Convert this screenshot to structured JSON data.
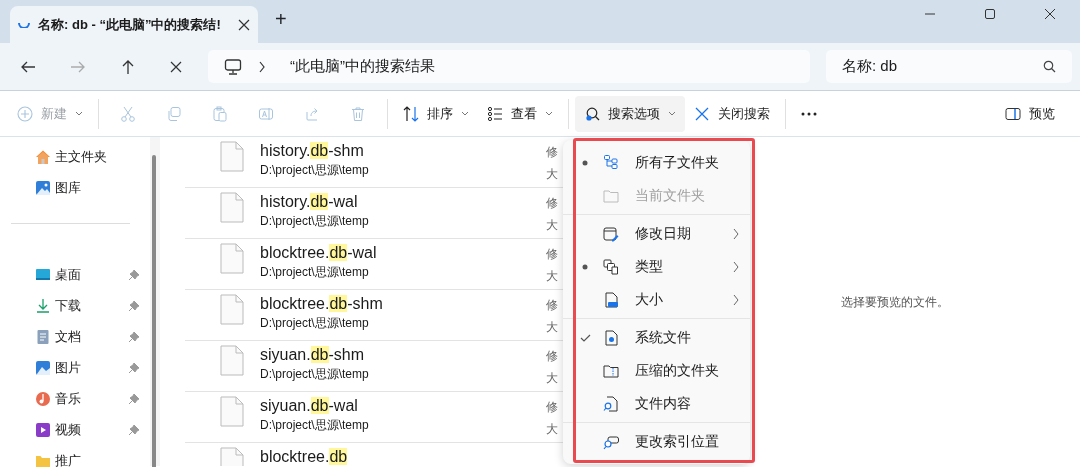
{
  "window": {
    "tab_title": "名称: db - “此电脑”中的搜索结!",
    "new_tab": "+"
  },
  "address": {
    "path": "“此电脑”中的搜索结果"
  },
  "search": {
    "value": "名称: db"
  },
  "toolbar": [
    {
      "kind": "new",
      "label": "新建",
      "disabled": true,
      "dropdown": true,
      "active": false
    },
    {
      "kind": "icon",
      "disabled": true,
      "dropdown": false,
      "active": false
    },
    {
      "kind": "icon",
      "disabled": true,
      "dropdown": false,
      "active": false
    },
    {
      "kind": "icon",
      "disabled": true,
      "dropdown": false,
      "active": false
    },
    {
      "kind": "icon",
      "disabled": true,
      "dropdown": false,
      "active": false
    },
    {
      "kind": "icon",
      "disabled": true,
      "dropdown": false,
      "active": false
    },
    {
      "kind": "icon",
      "disabled": true,
      "dropdown": false,
      "active": false
    },
    {
      "kind": "sort",
      "label": "排序",
      "disabled": false,
      "dropdown": true,
      "active": false
    },
    {
      "kind": "view",
      "label": "查看",
      "disabled": false,
      "dropdown": true,
      "active": false
    },
    {
      "kind": "search-options",
      "label": "搜索选项",
      "disabled": false,
      "dropdown": true,
      "active": true
    },
    {
      "kind": "close-search",
      "label": "关闭搜索",
      "disabled": false,
      "dropdown": false,
      "active": false
    },
    {
      "kind": "more",
      "disabled": false,
      "dropdown": false,
      "active": false
    }
  ],
  "preview_button": "预览",
  "sidebar": {
    "top": [
      {
        "label": "主文件夹",
        "pinned": false
      },
      {
        "label": "图库",
        "pinned": false
      }
    ],
    "items": [
      {
        "label": "桌面",
        "pinned": true
      },
      {
        "label": "下载",
        "pinned": true
      },
      {
        "label": "文档",
        "pinned": true
      },
      {
        "label": "图片",
        "pinned": true
      },
      {
        "label": "音乐",
        "pinned": true
      },
      {
        "label": "视频",
        "pinned": true
      },
      {
        "label": "推广",
        "pinned": false
      }
    ]
  },
  "files": [
    {
      "name": "history.**db**-shm",
      "path": "D:\\project\\思源\\temp",
      "column_2": "修",
      "column_3": "大"
    },
    {
      "name": "history.**db**-wal",
      "path": "D:\\project\\思源\\temp",
      "column_2": "修",
      "column_3": "大"
    },
    {
      "name": "blocktree.**db**-wal",
      "path": "D:\\project\\思源\\temp",
      "column_2": "修",
      "column_3": "大"
    },
    {
      "name": "blocktree.**db**-shm",
      "path": "D:\\project\\思源\\temp",
      "column_2": "修",
      "column_3": "大"
    },
    {
      "name": "siyuan.**db**-shm",
      "path": "D:\\project\\思源\\temp",
      "column_2": "修",
      "column_3": "大"
    },
    {
      "name": "siyuan.**db**-wal",
      "path": "D:\\project\\思源\\temp",
      "column_2": "修",
      "column_3": "大"
    },
    {
      "name": "blocktree.**db**"
    }
  ],
  "menu": {
    "groups": [
      [
        {
          "label": "所有子文件夹",
          "kind": "radio",
          "marked": true,
          "disabled": false
        },
        {
          "label": "当前文件夹",
          "kind": "radio",
          "marked": false,
          "disabled": true
        }
      ],
      [
        {
          "label": "修改日期",
          "kind": "submenu",
          "marked": false,
          "disabled": false
        },
        {
          "label": "类型",
          "kind": "submenu",
          "marked": true,
          "disabled": false
        },
        {
          "label": "大小",
          "kind": "submenu",
          "marked": false,
          "disabled": false
        }
      ],
      [
        {
          "label": "系统文件",
          "kind": "check",
          "marked": true,
          "disabled": false
        },
        {
          "label": "压缩的文件夹",
          "kind": "check",
          "marked": false,
          "disabled": false
        },
        {
          "label": "文件内容",
          "kind": "check",
          "marked": false,
          "disabled": false
        }
      ],
      [
        {
          "label": "更改索引位置",
          "kind": "action",
          "marked": false,
          "disabled": false
        }
      ]
    ]
  },
  "preview": {
    "message": "选择要预览的文件。"
  }
}
